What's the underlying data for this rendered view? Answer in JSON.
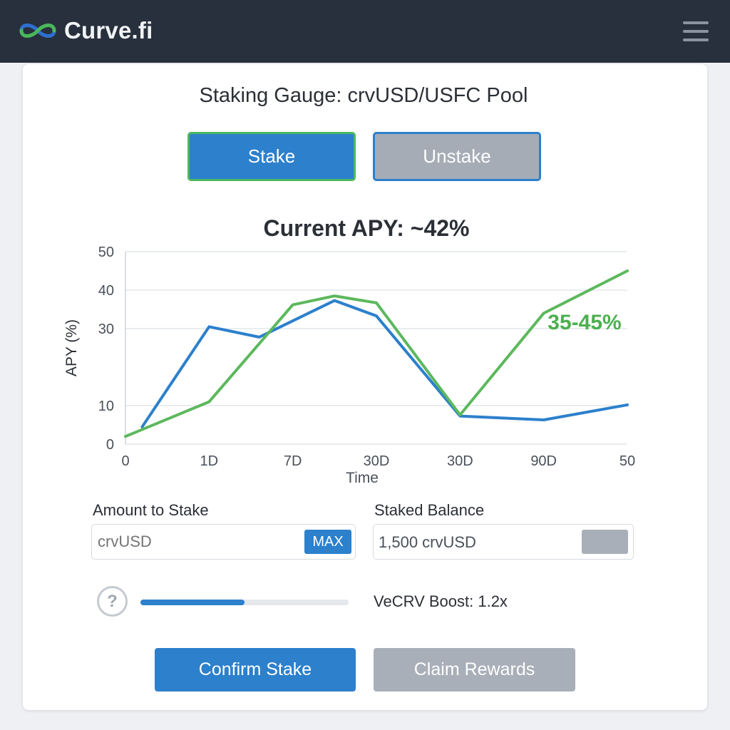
{
  "header": {
    "logo_text": "Curve.fi",
    "logo_icon": "curve-logo-icon",
    "menu_icon": "hamburger-menu-icon"
  },
  "page": {
    "title": "Staking Gauge: crvUSD/USFC Pool"
  },
  "tabs": {
    "stake_label": "Stake",
    "unstake_label": "Unstake",
    "active": "Stake"
  },
  "apy": {
    "heading": "Current APY: ~42%"
  },
  "chart_data": {
    "type": "line",
    "xlabel": "Time",
    "ylabel": "APY (%)",
    "ylim": [
      0,
      50
    ],
    "y_ticks": [
      0,
      10,
      30,
      40,
      50
    ],
    "x_tick_labels": [
      "0",
      "1D",
      "7D",
      "30D",
      "30D",
      "90D",
      "50"
    ],
    "grid": true,
    "annotation": {
      "text": "35-45%",
      "color": "#4caf50"
    },
    "series": [
      {
        "color": "#2c80cc",
        "points": [
          [
            0.2,
            4.5
          ],
          [
            1,
            30.5
          ],
          [
            1.6,
            27.8
          ],
          [
            2.5,
            37.3
          ],
          [
            3,
            33.3
          ],
          [
            4,
            7.3
          ],
          [
            5,
            6.3
          ],
          [
            6,
            10.2
          ]
        ]
      },
      {
        "color": "#5cb85c",
        "points": [
          [
            0,
            2
          ],
          [
            1,
            11
          ],
          [
            2,
            36.2
          ],
          [
            2.5,
            38.5
          ],
          [
            3,
            36.7
          ],
          [
            4,
            7.6
          ],
          [
            5,
            34
          ],
          [
            6,
            45
          ]
        ]
      }
    ]
  },
  "stake_form": {
    "amount_label": "Amount to Stake",
    "amount_placeholder": "crvUSD",
    "max_label": "MAX",
    "balance_label": "Staked Balance",
    "balance_value": "1,500 crvUSD"
  },
  "boost": {
    "help_icon": "help-circle-icon",
    "label": "VeCRV Boost: 1.2x",
    "slider_fraction": 0.5
  },
  "actions": {
    "confirm_label": "Confirm Stake",
    "claim_label": "Claim Rewards"
  },
  "colors": {
    "primary": "#2c80cc",
    "accent_green": "#4cb85e",
    "disabled": "#a8afb8",
    "header_bg": "#27303c"
  }
}
